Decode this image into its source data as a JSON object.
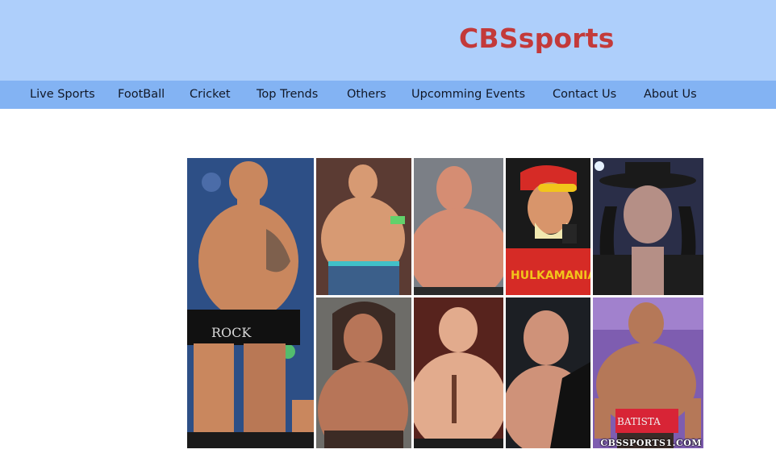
{
  "header": {
    "brand": "CBSsports",
    "background_color": "#aecffb",
    "brand_color": "#c33a3a"
  },
  "nav": {
    "background_color": "#83b3f3",
    "items": [
      {
        "label": "Live Sports"
      },
      {
        "label": "FootBall"
      },
      {
        "label": "Cricket"
      },
      {
        "label": "Top Trends"
      },
      {
        "label": "Others"
      },
      {
        "label": "Upcomming Events"
      },
      {
        "label": "Contact Us"
      },
      {
        "label": "About Us"
      }
    ]
  },
  "main": {
    "collage": {
      "description_icon": "wrestlers-collage-image",
      "tiles": [
        {
          "name": "wrestler-photo-1",
          "bg": "#2d4f86",
          "skin": "#c9875e",
          "trunks": "#111111"
        },
        {
          "name": "wrestler-photo-2",
          "bg": "#5b3b33",
          "skin": "#d79a73",
          "trunks": "#3b5f8a"
        },
        {
          "name": "wrestler-photo-3",
          "bg": "#7b7f86",
          "skin": "#d58d73",
          "trunks": "#000000"
        },
        {
          "name": "wrestler-photo-4",
          "bg": "#1a1a1a",
          "skin": "#d8956b",
          "trunks": "#d62b26"
        },
        {
          "name": "wrestler-photo-5",
          "bg": "#2a2e48",
          "skin": "#b58f86",
          "trunks": "#1d1d1d"
        },
        {
          "name": "wrestler-photo-6",
          "bg": "#6d6c68",
          "skin": "#b77558",
          "trunks": "#3c2b25"
        },
        {
          "name": "wrestler-photo-7",
          "bg": "#57231d",
          "skin": "#e2ab8d",
          "trunks": "#1c1c1c"
        },
        {
          "name": "wrestler-photo-8",
          "bg": "#1c1f24",
          "skin": "#cf9279",
          "trunks": "#111111"
        },
        {
          "name": "wrestler-photo-9",
          "bg": "#7e5db0",
          "skin": "#b57858",
          "trunks": "#d82436"
        }
      ],
      "watermark": "CBSSPORTS1.COM"
    }
  }
}
